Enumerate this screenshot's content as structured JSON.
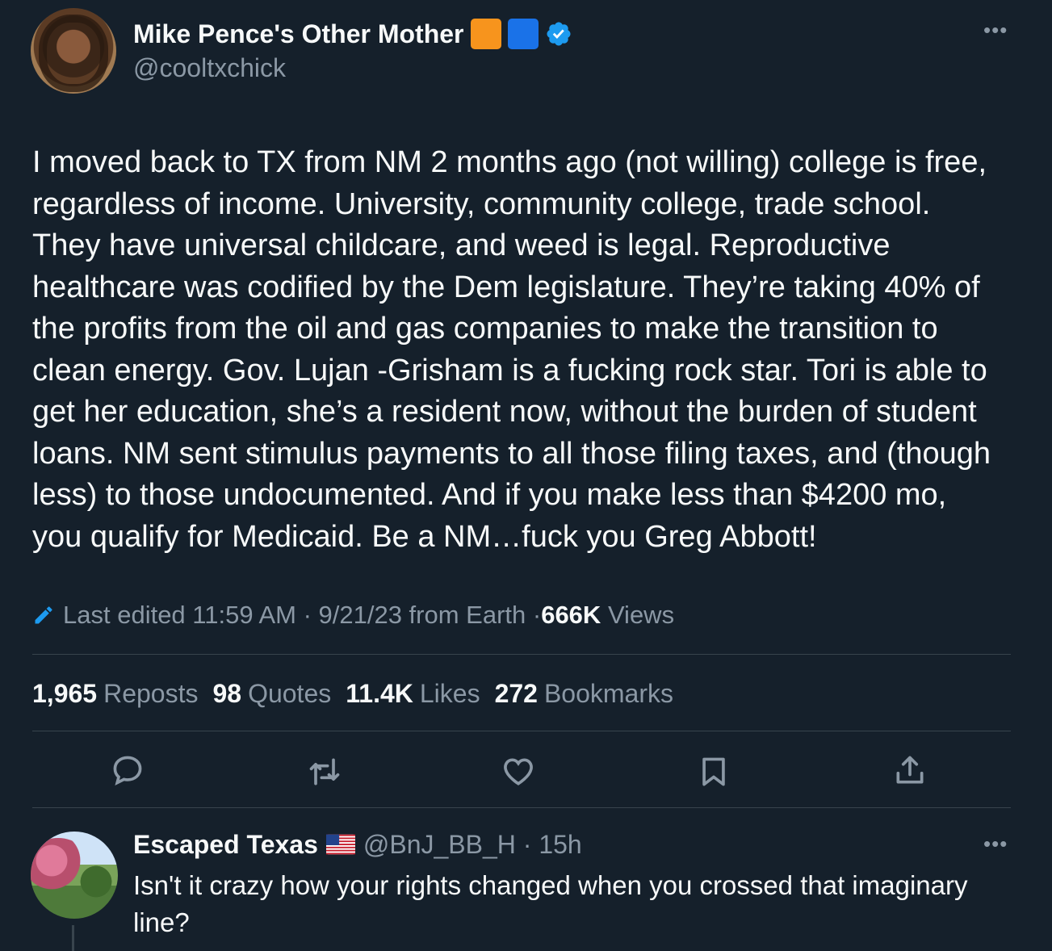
{
  "tweet": {
    "author_name": "Mike Pence's Other Mother",
    "handle": "@cooltxchick",
    "text": "I moved back to TX from NM 2 months ago (not willing) college is free,\nregardless of income. University, community college, trade school.\nThey have universal childcare, and weed is legal. Reproductive\nhealthcare was codified by the Dem legislature. They’re taking 40% of\nthe profits from the oil and gas companies to make the transition to\nclean energy. Gov. Lujan -Grisham is a fucking rock star. Tori is able to\nget her education, she’s a resident now, without the burden of student\nloans. NM sent stimulus payments to all those filing taxes, and (though\nless) to those undocumented. And if you make less than $4200 mo,\nyou qualify for Medicaid. Be a NM…fuck you Greg Abbott!",
    "meta": {
      "edited_label": "Last edited 11:59 AM · 9/21/23  from Earth · ",
      "views_count": "666K",
      "views_label": "Views"
    },
    "stats": {
      "reposts_count": "1,965",
      "reposts_label": "Reposts",
      "quotes_count": "98",
      "quotes_label": "Quotes",
      "likes_count": "11.4K",
      "likes_label": "Likes",
      "bookmarks_count": "272",
      "bookmarks_label": "Bookmarks"
    }
  },
  "reply": {
    "author_name": "Escaped Texas",
    "handle_time": "@BnJ_BB_H · 15h",
    "text": "Isn't it crazy how your rights changed when you crossed that imaginary line?"
  },
  "icons": {
    "header": [
      "orange-square-icon",
      "blue-square-icon",
      "verified-badge-icon",
      "more-icon"
    ],
    "meta": [
      "edit-pencil-icon"
    ],
    "actions": [
      "reply-icon",
      "repost-icon",
      "like-icon",
      "bookmark-icon",
      "share-icon"
    ],
    "reply": [
      "us-flag-icon",
      "more-icon"
    ]
  },
  "colors": {
    "background": "#15202b",
    "text": "#f7f9f9",
    "secondary_text": "#8b98a5",
    "accent": "#1d9bf0",
    "divider": "#38444d"
  }
}
